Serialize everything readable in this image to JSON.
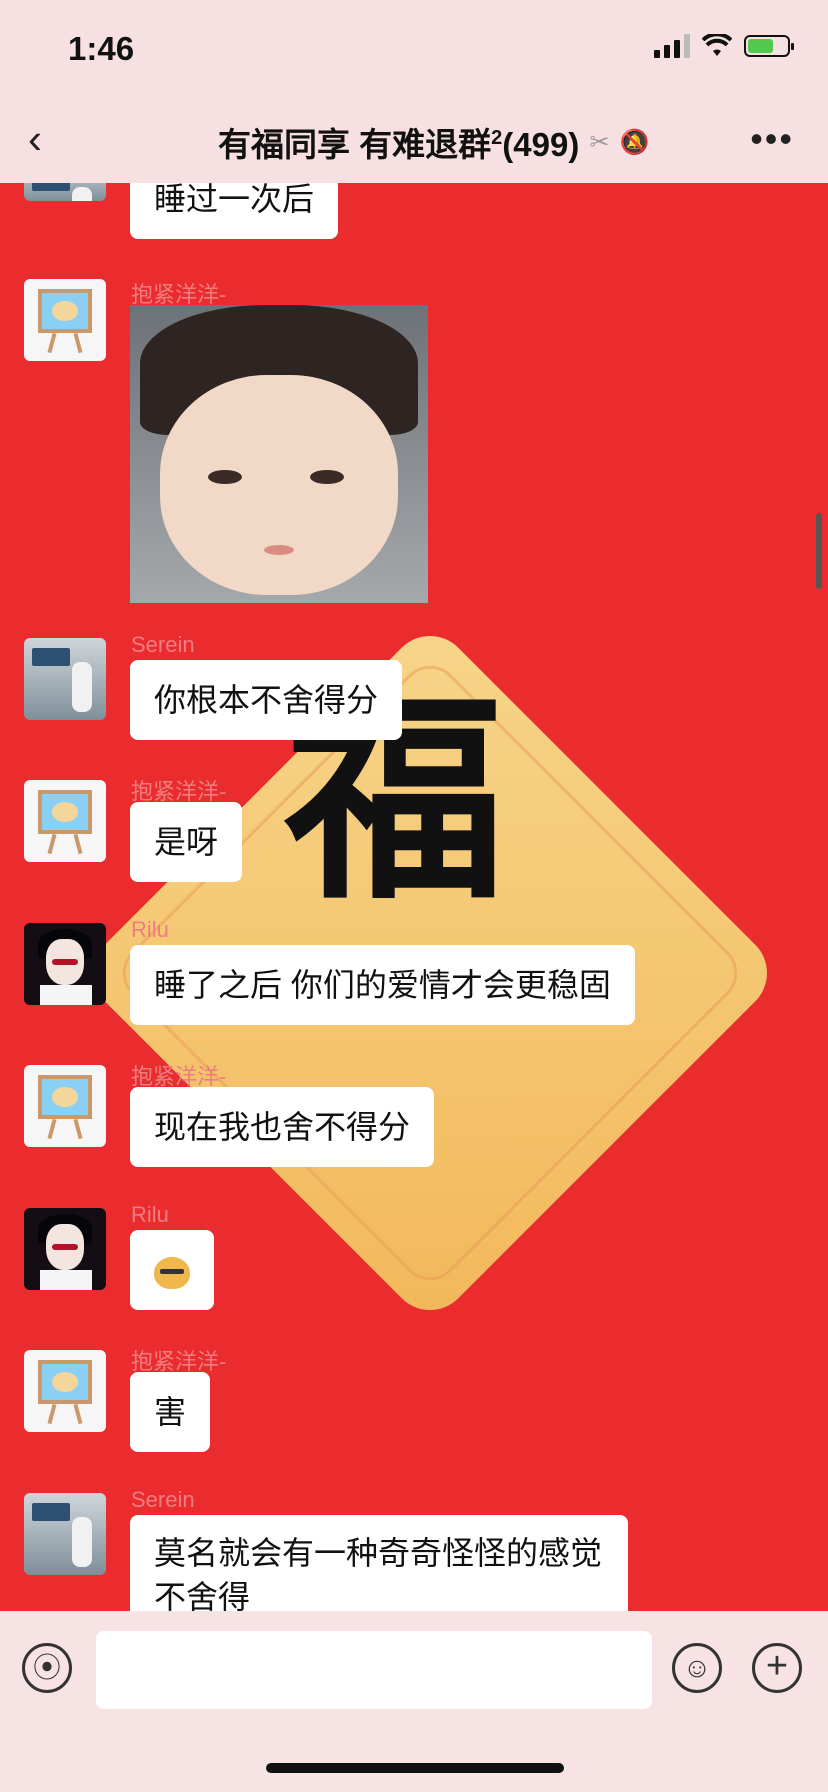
{
  "status": {
    "time": "1:46"
  },
  "header": {
    "title": "有福同享 有难退群",
    "title_sup": "2",
    "member_count": "(499)",
    "back_icon": "chevron-left-icon",
    "more_icon": "ellipsis-icon"
  },
  "messages": [
    {
      "nick": "",
      "avatar": "bakery",
      "text": "睡过一次后"
    },
    {
      "nick": "抱紧洋洋-",
      "avatar": "easel",
      "type": "image"
    },
    {
      "nick": "Serein",
      "avatar": "bakery",
      "text": "你根本不舍得分"
    },
    {
      "nick": "抱紧洋洋-",
      "avatar": "easel",
      "text": "是呀"
    },
    {
      "nick": "Rilu",
      "avatar": "anime",
      "text": "睡了之后 你们的爱情才会更稳固"
    },
    {
      "nick": "抱紧洋洋-",
      "avatar": "easel",
      "text": "现在我也舍不得分"
    },
    {
      "nick": "Rilu",
      "avatar": "anime",
      "type": "emoji",
      "emoji": "doge-emoji"
    },
    {
      "nick": "抱紧洋洋-",
      "avatar": "easel",
      "text": "害"
    },
    {
      "nick": "Serein",
      "avatar": "bakery",
      "text": "莫名就会有一种奇奇怪怪的感觉不舍得"
    }
  ],
  "background": {
    "character": "福"
  },
  "colors": {
    "chat_bg": "#ea2c2f",
    "header_bg": "#f6e0e1",
    "nick": "#f07c7f"
  }
}
